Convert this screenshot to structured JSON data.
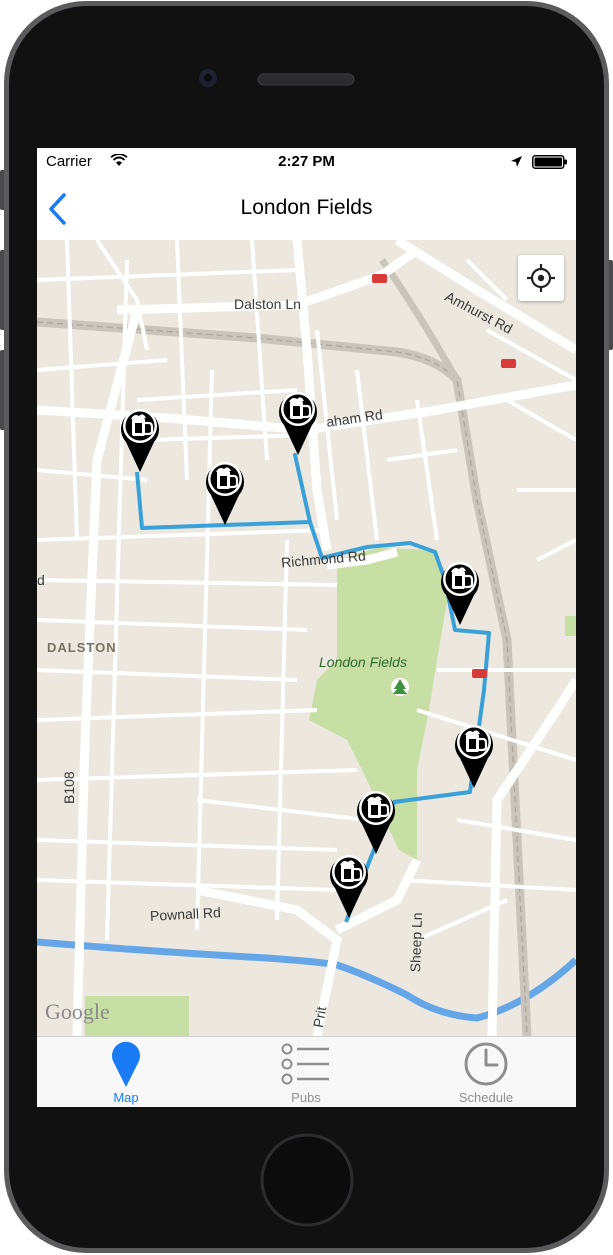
{
  "status_bar": {
    "carrier": "Carrier",
    "time": "2:27 PM"
  },
  "nav": {
    "title": "London Fields",
    "back_icon": "chevron-left-icon"
  },
  "map": {
    "street_labels": {
      "dalston_ln": "Dalston Ln",
      "amhurst_rd": "Amhurst Rd",
      "graham_rd": "aham Rd",
      "richmond_rd": "Richmond Rd",
      "left_edge_rd": "d",
      "b108": "B108",
      "pownall_rd": "Pownall Rd",
      "sheep_ln": "Sheep Ln",
      "pritchards": "Prit"
    },
    "district_label": "DALSTON",
    "park_label": "London Fields",
    "attribution": "Google",
    "route_color": "#39a0d8",
    "park_color": "#c7dfa4",
    "pin_icon": "beer-mug-icon",
    "pin_count": 7
  },
  "tabs": [
    {
      "label": "Map",
      "icon": "map-pin-icon",
      "active": true
    },
    {
      "label": "Pubs",
      "icon": "list-icon",
      "active": false
    },
    {
      "label": "Schedule",
      "icon": "clock-icon",
      "active": false
    }
  ],
  "colors": {
    "accent": "#1a7cf5",
    "inactive": "#8e8e8e"
  }
}
